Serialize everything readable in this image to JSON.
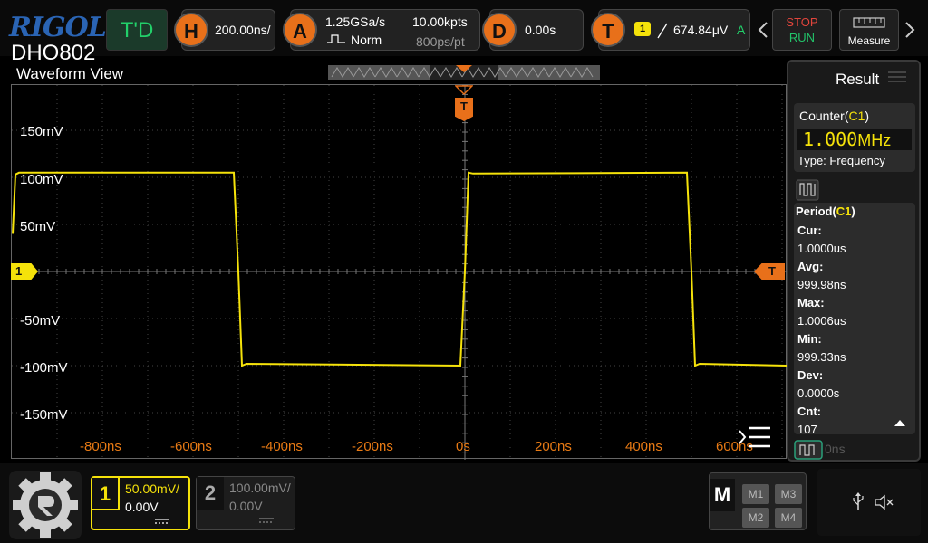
{
  "brand": {
    "logo": "RIGOL",
    "model": "DHO802"
  },
  "topbar": {
    "td_label": "T'D",
    "h_icon": "H",
    "h_value": "200.00ns/",
    "a_icon": "A",
    "sample_rate": "1.25GSa/s",
    "acq_mode": "Norm",
    "mem_depth": "10.00kpts",
    "sample_interval": "800ps/pt",
    "d_icon": "D",
    "delay": "0.00s",
    "t_icon": "T",
    "trig_source": "1",
    "trig_level": "674.84μV",
    "trig_mode": "A",
    "stop": "STOP",
    "run": "RUN",
    "measure": "Measure"
  },
  "waveform": {
    "title": "Waveform View",
    "y_labels": [
      "150mV",
      "100mV",
      "50mV",
      "-50mV",
      "-100mV",
      "-150mV"
    ],
    "x_labels": [
      "-800ns",
      "-600ns",
      "-400ns",
      "-200ns",
      "0s",
      "200ns",
      "400ns",
      "600ns"
    ],
    "x_label_partial": "0ns",
    "ch_marker": "1",
    "trig_marker": "T",
    "trig_pos_marker": "T",
    "signal": {
      "type": "square",
      "period_ns": 1000,
      "high_mv": 105,
      "low_mv": -100,
      "edges_ns": [
        -500,
        0,
        500
      ]
    }
  },
  "result": {
    "title": "Result",
    "counter_label": "Counter(",
    "counter_ch": "C1",
    "counter_close": ")",
    "counter_value": "1.000",
    "counter_unit": "MHz",
    "counter_type": "Type:  Frequency",
    "period_label": "Period(",
    "period_ch": "C1",
    "period_close": ")",
    "stats": [
      {
        "k": "Cur:",
        "v": "1.0000us"
      },
      {
        "k": "Avg:",
        "v": "999.98ns"
      },
      {
        "k": "Max:",
        "v": "1.0006us"
      },
      {
        "k": "Min:",
        "v": "999.33ns"
      },
      {
        "k": "Dev:",
        "v": "0.0000s"
      },
      {
        "k": "Cnt:",
        "v": "107"
      }
    ]
  },
  "bottom": {
    "ch1": {
      "num": "1",
      "scale": "50.00mV/",
      "offset": "0.00V"
    },
    "ch2": {
      "num": "2",
      "scale": "100.00mV/",
      "offset": "0.00V"
    },
    "math": {
      "label": "M",
      "m1": "M1",
      "m2": "M2",
      "m3": "M3",
      "m4": "M4"
    }
  },
  "colors": {
    "ch1": "#f5e20a",
    "trigger": "#e8701a",
    "brand": "#2a64b4",
    "td": "#22d06a",
    "run": "#22c46a",
    "stop": "#e2453c"
  }
}
